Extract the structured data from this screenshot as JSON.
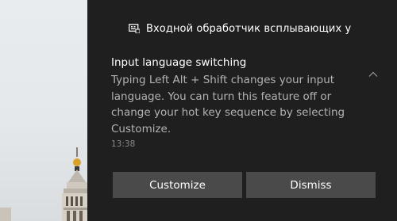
{
  "notification": {
    "app_name": "Входной обработчик всплывающих у",
    "app_icon": "keyboard-popup-icon",
    "title": "Input language switching",
    "body": "Typing Left Alt + Shift changes your input language. You can turn this feature off or change your hot key sequence by selecting Customize.",
    "time": "13:38",
    "collapse_icon": "chevron-up-icon",
    "buttons": {
      "customize": "Customize",
      "dismiss": "Dismiss"
    }
  },
  "colors": {
    "panel_background": "#1f1f1f",
    "button_background": "#4a4a4a",
    "title_text": "#ffffff",
    "body_text": "#b3b3b3",
    "time_text": "#8a8a8a"
  },
  "wallpaper": {
    "description_icon": "tower-wallpaper"
  }
}
